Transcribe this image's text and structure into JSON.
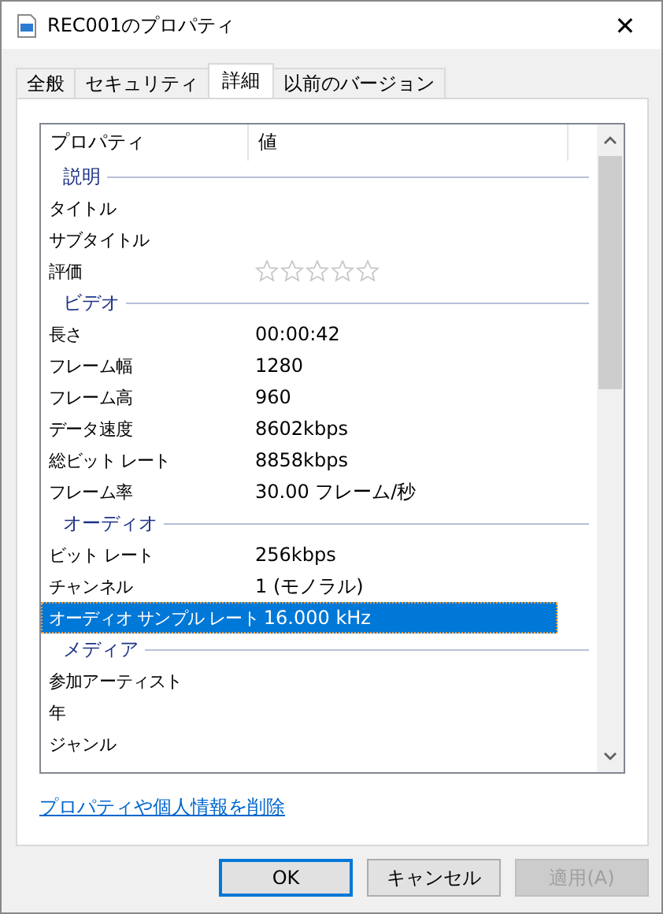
{
  "window": {
    "title": "REC001のプロパティ",
    "close": "✕"
  },
  "tabs": [
    {
      "label": "全般",
      "selected": false
    },
    {
      "label": "セキュリティ",
      "selected": false
    },
    {
      "label": "詳細",
      "selected": true
    },
    {
      "label": "以前のバージョン",
      "selected": false
    }
  ],
  "table": {
    "columns": [
      "プロパティ",
      "値"
    ],
    "rows": [
      {
        "kind": "group",
        "label": "説明"
      },
      {
        "kind": "prop",
        "name": "タイトル",
        "value": "",
        "selected": false
      },
      {
        "kind": "prop",
        "name": "サブタイトル",
        "value": "",
        "selected": false
      },
      {
        "kind": "rating",
        "name": "評価",
        "stars": 0,
        "selected": false
      },
      {
        "kind": "group",
        "label": "ビデオ"
      },
      {
        "kind": "prop",
        "name": "長さ",
        "value": "00:00:42",
        "selected": false
      },
      {
        "kind": "prop",
        "name": "フレーム幅",
        "value": "1280",
        "selected": false
      },
      {
        "kind": "prop",
        "name": "フレーム高",
        "value": "960",
        "selected": false
      },
      {
        "kind": "prop",
        "name": "データ速度",
        "value": "8602kbps",
        "selected": false
      },
      {
        "kind": "prop",
        "name": "総ビット レート",
        "value": "8858kbps",
        "selected": false
      },
      {
        "kind": "prop",
        "name": "フレーム率",
        "value": "30.00 フレーム/秒",
        "selected": false
      },
      {
        "kind": "group",
        "label": "オーディオ"
      },
      {
        "kind": "prop",
        "name": "ビット レート",
        "value": "256kbps",
        "selected": false
      },
      {
        "kind": "prop",
        "name": "チャンネル",
        "value": "1 (モノラル)",
        "selected": false
      },
      {
        "kind": "prop",
        "name": "オーディオ サンプル レート",
        "value": "16.000 kHz",
        "selected": true
      },
      {
        "kind": "group",
        "label": "メディア"
      },
      {
        "kind": "prop",
        "name": "参加アーティスト",
        "value": "",
        "selected": false
      },
      {
        "kind": "prop",
        "name": "年",
        "value": "",
        "selected": false
      },
      {
        "kind": "prop",
        "name": "ジャンル",
        "value": "",
        "selected": false
      }
    ]
  },
  "link": "プロパティや個人情報を削除",
  "buttons": [
    {
      "label": "OK",
      "kind": "default",
      "disabled": false
    },
    {
      "label": "キャンセル",
      "kind": "normal",
      "disabled": false
    },
    {
      "label": "適用(A)",
      "kind": "normal",
      "disabled": true
    }
  ]
}
